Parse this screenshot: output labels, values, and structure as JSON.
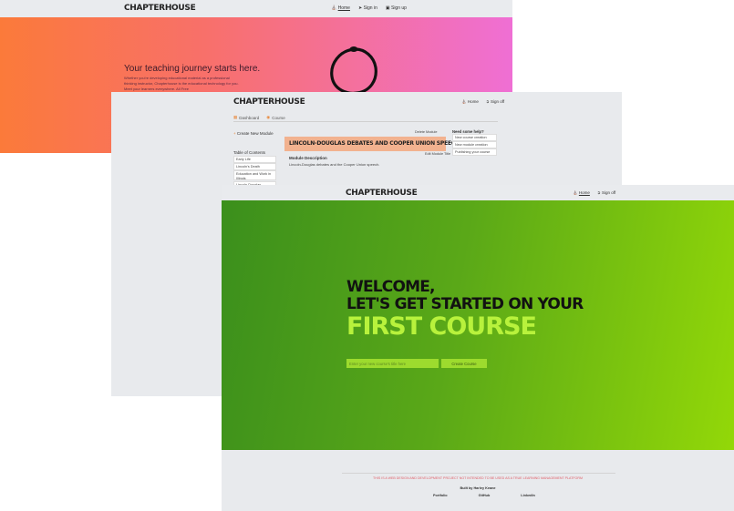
{
  "screen1": {
    "brand": "CHAPTERHOUSE",
    "nav": {
      "home": "Home",
      "signin": "Sign in",
      "signup": "Sign up"
    },
    "hero": {
      "headline": "Your teaching journey starts here.",
      "sub_line1": "Whether you're developing educational material as a professional",
      "sub_line2": "thinking instructor, Chapterhouse is the educational technology for you.",
      "sub_line3": "Meet your learners everywhere. All Free"
    },
    "colors": {
      "hero_start": "#fb7a3a",
      "hero_end": "#ef6fd4"
    }
  },
  "screen2": {
    "brand": "CHAPTERHOUSE",
    "nav": {
      "home": "Home",
      "signoff": "Sign off"
    },
    "tabs": [
      {
        "label": "Dashboard"
      },
      {
        "label": "Course"
      }
    ],
    "create_module": "Create New Module",
    "toc_title": "Table of Contents",
    "toc_items": [
      "Early Life",
      "Lincoln's Death",
      "Education and Work in Illinois",
      "Lincoln-Douglas Debates"
    ],
    "delete_module": "Delete Module",
    "module_title": "LINCOLN-DOUGLAS DEBATES AND COOPER UNION SPEECH",
    "edit_module_title": "Edit Module Title",
    "module_desc_title": "Module Description",
    "module_desc_text": "Lincoln-Douglas debates and the Cooper Union speech.",
    "help_title": "Need some help?",
    "help_items": [
      "New course creation",
      "New module creation",
      "Publishing your course"
    ],
    "colors": {
      "banner": "#f2b28f"
    }
  },
  "screen3": {
    "brand": "CHAPTERHOUSE",
    "nav": {
      "home": "Home",
      "signoff": "Sign off"
    },
    "hero": {
      "line1": "WELCOME,",
      "line2": "LET'S GET STARTED ON YOUR",
      "line3": "FIRST COURSE",
      "input_placeholder": "Enter your new course's title here",
      "create_button": "Create Course"
    },
    "footer": {
      "disclaimer": "THIS IS A WEB DESIGN AND DEVELOPMENT PROJECT NOT INTENDED TO BE USED AS A TRUE LEARNING MANAGEMENT PLATFORM",
      "built_by": "Built by Harley Keane",
      "links": [
        "Portfolio",
        "GitHub",
        "LinkedIn"
      ]
    },
    "colors": {
      "hero_start": "#3b8f1c",
      "hero_end": "#93d808",
      "accent": "#b8f23c"
    }
  }
}
